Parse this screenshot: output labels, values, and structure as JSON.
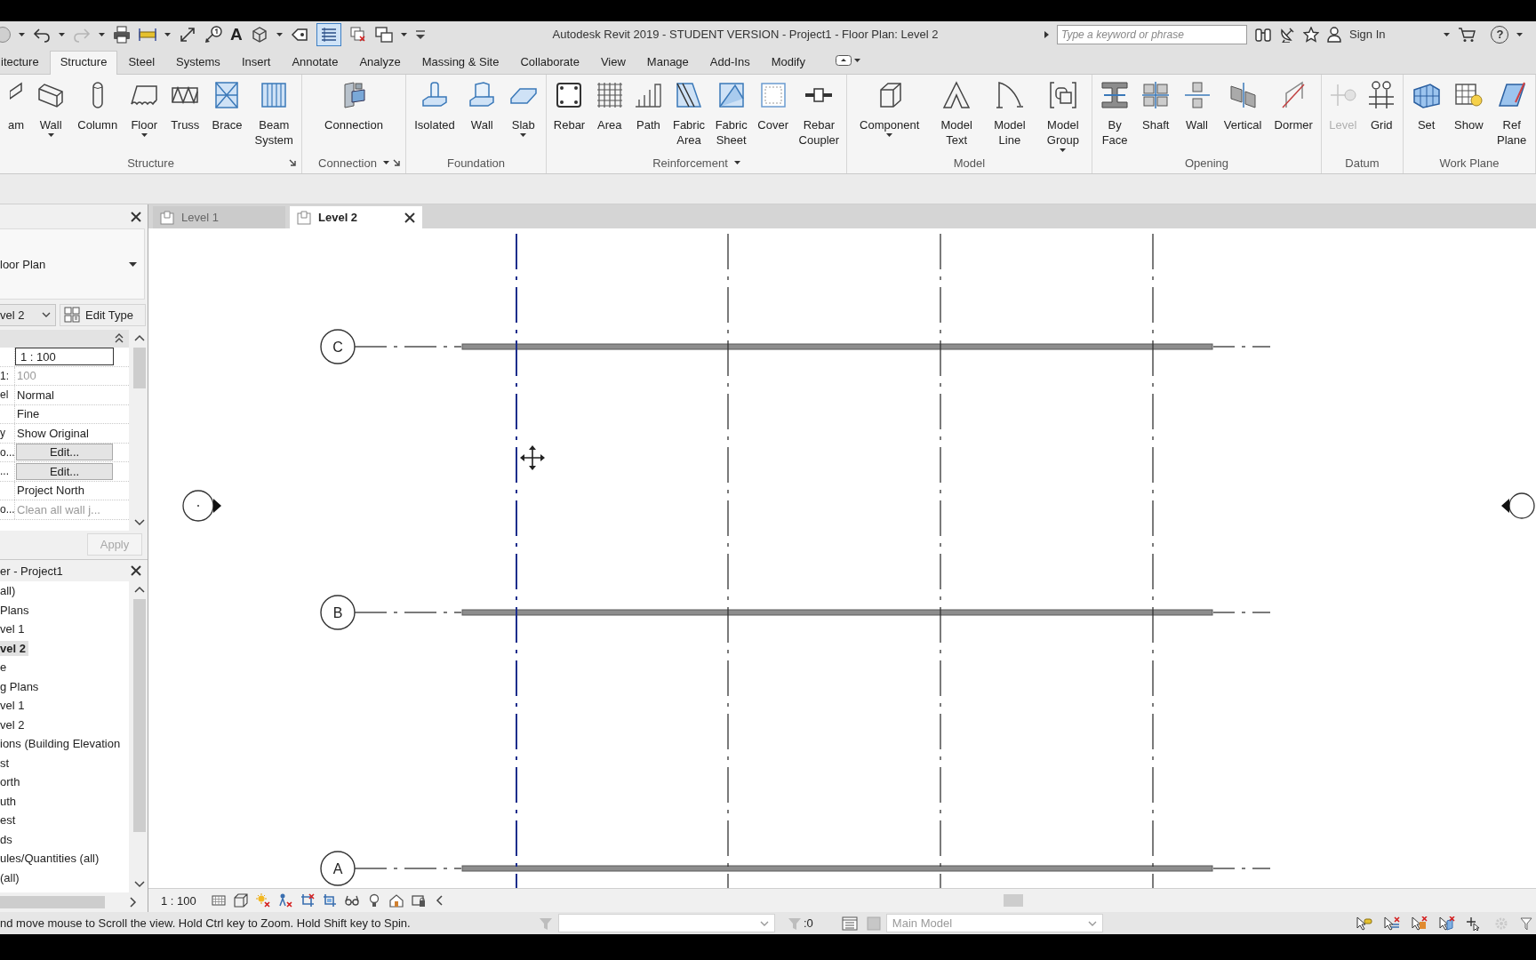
{
  "title_bar": {
    "text_tool": "A",
    "thin_lines_selected": true,
    "title": "Autodesk Revit 2019 - STUDENT VERSION - Project1 - Floor Plan: Level 2",
    "search": {
      "placeholder": "Type a keyword or phrase"
    },
    "sign_in": "Sign In",
    "help": "?"
  },
  "ribbon": {
    "tabs": [
      {
        "label": "itecture",
        "selected": false
      },
      {
        "label": "Structure",
        "selected": true
      },
      {
        "label": "Steel",
        "selected": false
      },
      {
        "label": "Systems",
        "selected": false
      },
      {
        "label": "Insert",
        "selected": false
      },
      {
        "label": "Annotate",
        "selected": false
      },
      {
        "label": "Analyze",
        "selected": false
      },
      {
        "label": "Massing & Site",
        "selected": false
      },
      {
        "label": "Collaborate",
        "selected": false
      },
      {
        "label": "View",
        "selected": false
      },
      {
        "label": "Manage",
        "selected": false
      },
      {
        "label": "Add-Ins",
        "selected": false
      },
      {
        "label": "Modify",
        "selected": false
      }
    ],
    "panels": [
      {
        "title": "Structure",
        "menu": false,
        "launcher": true,
        "buttons": [
          {
            "label": "am",
            "dropdown": false,
            "disabled": false
          },
          {
            "label": "Wall",
            "dropdown": true,
            "disabled": false
          },
          {
            "label": "Column",
            "dropdown": false,
            "disabled": false
          },
          {
            "label": "Floor",
            "dropdown": true,
            "disabled": false
          },
          {
            "label": "Truss",
            "dropdown": false,
            "disabled": false
          },
          {
            "label": "Brace",
            "dropdown": false,
            "disabled": false
          },
          {
            "label": "Beam System",
            "dropdown": false,
            "disabled": false
          }
        ]
      },
      {
        "title": "Connection",
        "menu": true,
        "launcher": true,
        "buttons": [
          {
            "label": "Connection",
            "dropdown": false,
            "disabled": false
          }
        ]
      },
      {
        "title": "Foundation",
        "menu": false,
        "launcher": false,
        "buttons": [
          {
            "label": "Isolated",
            "dropdown": false,
            "disabled": false
          },
          {
            "label": "Wall",
            "dropdown": false,
            "disabled": false
          },
          {
            "label": "Slab",
            "dropdown": true,
            "disabled": false
          }
        ]
      },
      {
        "title": "Reinforcement",
        "menu": true,
        "launcher": false,
        "buttons": [
          {
            "label": "Rebar",
            "dropdown": false,
            "disabled": false
          },
          {
            "label": "Area",
            "dropdown": false,
            "disabled": false
          },
          {
            "label": "Path",
            "dropdown": false,
            "disabled": false
          },
          {
            "label": "Fabric Area",
            "dropdown": false,
            "disabled": false
          },
          {
            "label": "Fabric Sheet",
            "dropdown": false,
            "disabled": false
          },
          {
            "label": "Cover",
            "dropdown": false,
            "disabled": false
          },
          {
            "label": "Rebar Coupler",
            "dropdown": false,
            "disabled": false
          }
        ]
      },
      {
        "title": "Model",
        "menu": false,
        "launcher": false,
        "buttons": [
          {
            "label": "Component",
            "dropdown": true,
            "disabled": false
          },
          {
            "label": "Model Text",
            "dropdown": false,
            "disabled": false
          },
          {
            "label": "Model Line",
            "dropdown": false,
            "disabled": false
          },
          {
            "label": "Model Group",
            "dropdown": true,
            "disabled": false
          }
        ]
      },
      {
        "title": "Opening",
        "menu": false,
        "launcher": false,
        "buttons": [
          {
            "label": "By Face",
            "dropdown": false,
            "disabled": false
          },
          {
            "label": "Shaft",
            "dropdown": false,
            "disabled": false
          },
          {
            "label": "Wall",
            "dropdown": false,
            "disabled": false
          },
          {
            "label": "Vertical",
            "dropdown": false,
            "disabled": false
          },
          {
            "label": "Dormer",
            "dropdown": false,
            "disabled": false
          }
        ]
      },
      {
        "title": "Datum",
        "menu": false,
        "launcher": false,
        "buttons": [
          {
            "label": "Level",
            "dropdown": false,
            "disabled": true
          },
          {
            "label": "Grid",
            "dropdown": false,
            "disabled": false
          }
        ]
      },
      {
        "title": "Work Plane",
        "menu": false,
        "launcher": false,
        "buttons": [
          {
            "label": "Set",
            "dropdown": false,
            "disabled": false
          },
          {
            "label": "Show",
            "dropdown": false,
            "disabled": false
          },
          {
            "label": "Ref Plane",
            "dropdown": false,
            "disabled": false
          }
        ]
      }
    ]
  },
  "view_tabs": [
    {
      "label": "Level 1",
      "selected": false
    },
    {
      "label": "Level 2",
      "selected": true
    }
  ],
  "properties": {
    "type": "loor Plan",
    "instance": "vel 2",
    "edit_type": "Edit Type",
    "rows": [
      {
        "kind": "input",
        "value": "1 : 100",
        "disabled": false
      },
      {
        "kind": "text",
        "name": "1:",
        "value": "100",
        "disabled": true
      },
      {
        "kind": "text",
        "name": "el",
        "value": "Normal",
        "disabled": false
      },
      {
        "kind": "text",
        "value": "Fine",
        "disabled": false
      },
      {
        "kind": "text",
        "name": "y",
        "value": "Show Original",
        "disabled": false
      },
      {
        "kind": "button",
        "name": "o...",
        "value": "Edit...",
        "disabled": false
      },
      {
        "kind": "button",
        "name": "...",
        "value": "Edit...",
        "disabled": false
      },
      {
        "kind": "text",
        "value": "Project North",
        "disabled": false
      },
      {
        "kind": "text",
        "name": "o...",
        "value": "Clean all wall j...",
        "disabled": true
      }
    ],
    "apply": {
      "label": "Apply",
      "disabled": true
    }
  },
  "project_browser": {
    "title": "er - Project1",
    "items": [
      {
        "label": "all)",
        "selected": false
      },
      {
        "label": "Plans",
        "selected": false
      },
      {
        "label": "vel 1",
        "selected": false
      },
      {
        "label": "vel 2",
        "selected": true
      },
      {
        "label": "e",
        "selected": false
      },
      {
        "label": "g Plans",
        "selected": false
      },
      {
        "label": "vel 1",
        "selected": false
      },
      {
        "label": "vel 2",
        "selected": false
      },
      {
        "label": "ions (Building Elevation",
        "selected": false
      },
      {
        "label": "st",
        "selected": false
      },
      {
        "label": "orth",
        "selected": false
      },
      {
        "label": "uth",
        "selected": false
      },
      {
        "label": "est",
        "selected": false
      },
      {
        "label": "ds",
        "selected": false
      },
      {
        "label": "ules/Quantities (all)",
        "selected": false
      },
      {
        "label": "(all)",
        "selected": false
      }
    ]
  },
  "canvas": {
    "grid_rows": [
      {
        "label": "C"
      },
      {
        "label": "B"
      },
      {
        "label": "A"
      }
    ],
    "grid_columns": [
      {
        "highlighted": true
      },
      {
        "highlighted": false
      },
      {
        "highlighted": false
      },
      {
        "highlighted": false
      }
    ]
  },
  "view_control_bar": {
    "scale": "1 : 100"
  },
  "status_bar": {
    "message": "nd move mouse to Scroll the view. Hold Ctrl key to Zoom. Hold Shift key to Spin.",
    "selection_count": ":0",
    "model": {
      "label": "Main Model",
      "disabled": true
    }
  }
}
